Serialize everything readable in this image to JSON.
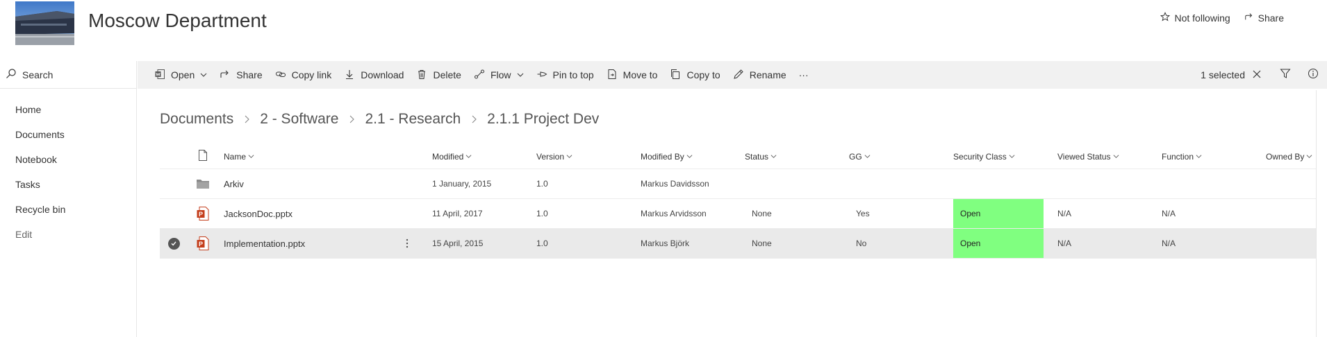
{
  "site": {
    "title": "Moscow Department"
  },
  "header_actions": {
    "follow": "Not following",
    "share": "Share"
  },
  "search": {
    "placeholder": "Search"
  },
  "nav": {
    "home": "Home",
    "documents": "Documents",
    "notebook": "Notebook",
    "tasks": "Tasks",
    "recycle_bin": "Recycle bin",
    "edit": "Edit"
  },
  "commands": {
    "open": "Open",
    "share": "Share",
    "copy_link": "Copy link",
    "download": "Download",
    "delete": "Delete",
    "flow": "Flow",
    "pin_to_top": "Pin to top",
    "move_to": "Move to",
    "copy_to": "Copy to",
    "rename": "Rename",
    "more": "···"
  },
  "selection": {
    "text": "1 selected"
  },
  "breadcrumb": [
    "Documents",
    "2 - Software",
    "2.1 - Research",
    "2.1.1 Project Dev"
  ],
  "columns": {
    "name": "Name",
    "modified": "Modified",
    "version": "Version",
    "modified_by": "Modified By",
    "status": "Status",
    "gg": "GG",
    "security_class": "Security Class",
    "viewed_status": "Viewed Status",
    "function": "Function",
    "owned_by": "Owned By"
  },
  "rows": [
    {
      "type": "folder",
      "name": "Arkiv",
      "modified": "1 January, 2015",
      "version": "1.0",
      "modified_by": "Markus Davidsson",
      "status": "",
      "gg": "",
      "security_class": "",
      "viewed_status": "",
      "function": "",
      "owned_by": "",
      "selected": false
    },
    {
      "type": "pptx",
      "name": "JacksonDoc.pptx",
      "modified": "11 April, 2017",
      "version": "1.0",
      "modified_by": "Markus Arvidsson",
      "status": "None",
      "gg": "Yes",
      "security_class": "Open",
      "viewed_status": "N/A",
      "function": "N/A",
      "owned_by": "",
      "selected": false
    },
    {
      "type": "pptx",
      "name": "Implementation.pptx",
      "modified": "15 April, 2015",
      "version": "1.0",
      "modified_by": "Markus Björk",
      "status": "None",
      "gg": "No",
      "security_class": "Open",
      "viewed_status": "N/A",
      "function": "N/A",
      "owned_by": "",
      "selected": true
    }
  ],
  "colors": {
    "security_open": "#80ff80",
    "selected_row": "#eaeaea",
    "command_bar": "#f1f1f1",
    "pptx_red": "#c43e1c"
  },
  "icons": {
    "follow": "star-icon",
    "share": "share-icon",
    "search": "search-icon",
    "open": "word-icon",
    "copy_link": "link-icon",
    "download": "download-icon",
    "delete": "trash-icon",
    "flow": "flow-icon",
    "pin": "pin-icon",
    "move": "move-icon",
    "copy": "copy-icon",
    "rename": "pencil-icon",
    "close": "close-icon",
    "filter": "filter-icon",
    "info": "info-icon",
    "file_type": "document-icon",
    "folder": "folder-icon",
    "pptx": "powerpoint-icon",
    "check": "checkmark-icon",
    "row_more": "vertical-ellipsis-icon"
  }
}
